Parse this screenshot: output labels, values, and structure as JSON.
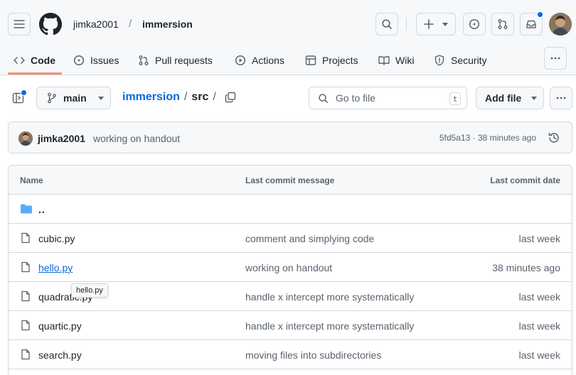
{
  "header": {
    "owner": "jimka2001",
    "separator": "/",
    "repo": "immersion"
  },
  "tabs": [
    {
      "label": "Code",
      "icon": "code-icon",
      "active": true
    },
    {
      "label": "Issues",
      "icon": "issue-opened-icon"
    },
    {
      "label": "Pull requests",
      "icon": "git-pull-request-icon"
    },
    {
      "label": "Actions",
      "icon": "play-icon"
    },
    {
      "label": "Projects",
      "icon": "table-icon"
    },
    {
      "label": "Wiki",
      "icon": "book-icon"
    },
    {
      "label": "Security",
      "icon": "shield-icon"
    }
  ],
  "toolbar": {
    "branch": "main",
    "breadcrumb": {
      "repo_link": "immersion",
      "sep1": "/",
      "dir": "src",
      "sep2": "/"
    },
    "search_placeholder": "Go to file",
    "search_shortcut": "t",
    "add_file_label": "Add file"
  },
  "commit": {
    "author": "jimka2001",
    "message": "working on handout",
    "sha": "5fd5a13",
    "dot": "·",
    "time": "38 minutes ago"
  },
  "table": {
    "headers": {
      "name": "Name",
      "message": "Last commit message",
      "date": "Last commit date"
    },
    "parent": "..",
    "rows": [
      {
        "name": "cubic.py",
        "message": "comment and simplying code",
        "date": "last week"
      },
      {
        "name": "hello.py",
        "message": "working on handout",
        "date": "38 minutes ago",
        "hovered": true
      },
      {
        "name": "quadratic.py",
        "message": "handle x intercept more systematically",
        "date": "last week"
      },
      {
        "name": "quartic.py",
        "message": "handle x intercept more systematically",
        "date": "last week"
      },
      {
        "name": "search.py",
        "message": "moving files into subdirectories",
        "date": "last week"
      }
    ],
    "tooltip": "hello.py"
  },
  "colors": {
    "accent": "#0969da",
    "tab_underline": "#fd8c73",
    "folder": "#54aeff"
  }
}
